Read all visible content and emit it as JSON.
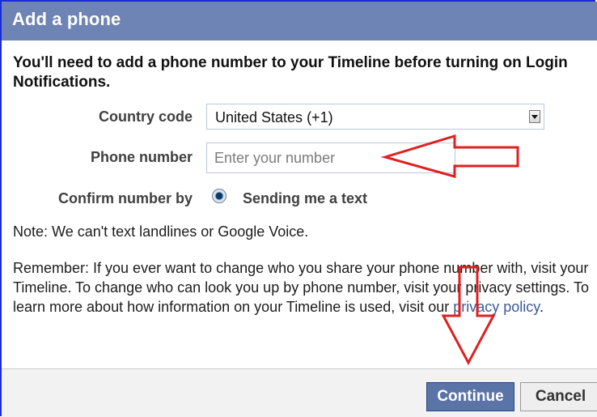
{
  "dialog": {
    "title": "Add a phone",
    "heading": "You'll need to add a phone number to your Timeline before turning on Login Notifications."
  },
  "form": {
    "country_code_label": "Country code",
    "country_code_value": "United States (+1)",
    "phone_label": "Phone number",
    "phone_placeholder": "Enter your number",
    "confirm_label": "Confirm number by",
    "confirm_option": "Sending me a text"
  },
  "note": "Note: We can't text landlines or Google Voice.",
  "remember": {
    "text": "Remember: If you ever want to change who you share your phone number with, visit your Timeline. To change who can look you up by phone number, visit your privacy settings. To learn more about how information on your Timeline is used, visit our ",
    "link": "privacy policy",
    "end": "."
  },
  "buttons": {
    "continue": "Continue",
    "cancel": "Cancel"
  },
  "colors": {
    "header": "#6d84b4",
    "annotation": "#e02020",
    "frame": "#1a2bd8"
  }
}
